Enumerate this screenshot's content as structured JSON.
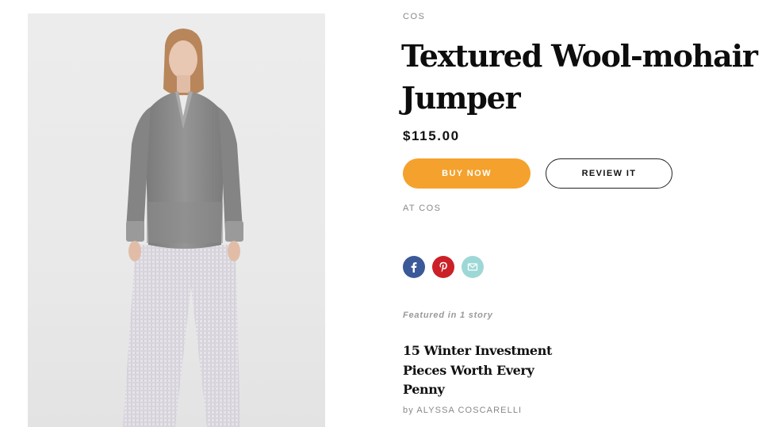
{
  "product": {
    "brand": "COS",
    "title": "Textured Wool-mohair Jumper",
    "price": "$115.00",
    "image_alt": "Model wearing grey textured wool-mohair jumper with white check trousers"
  },
  "actions": {
    "buy_label": "BUY NOW",
    "review_label": "REVIEW IT",
    "buy_color": "#f4a22d"
  },
  "retailer": "AT COS",
  "share": [
    {
      "network": "facebook",
      "icon": "facebook-icon",
      "color": "#3b5998"
    },
    {
      "network": "pinterest",
      "icon": "pinterest-icon",
      "color": "#cb2027"
    },
    {
      "network": "email",
      "icon": "email-icon",
      "color": "#9ed8d6"
    }
  ],
  "featured": {
    "label": "Featured in 1 story",
    "story_title": "15 Winter Investment Pieces Worth Every Penny",
    "byline": "by ALYSSA COSCARELLI"
  }
}
